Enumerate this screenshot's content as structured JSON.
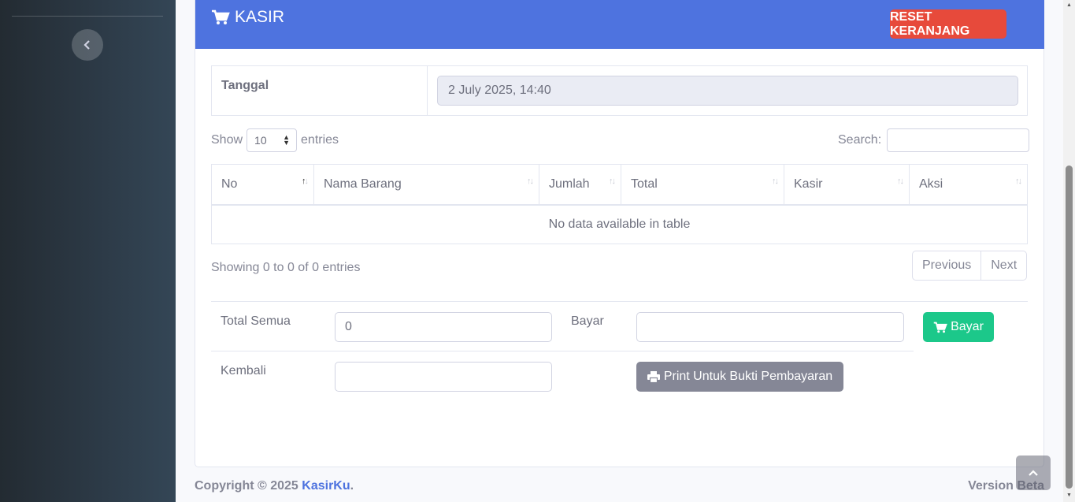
{
  "header": {
    "title": "KASIR",
    "reset_label": "RESET KERANJANG",
    "icon": "shopping-cart-icon"
  },
  "date": {
    "label": "Tanggal",
    "value": "2 July 2025, 14:40"
  },
  "table_controls": {
    "show_label": "Show",
    "entries_value": "10",
    "entries_label": "entries",
    "search_label": "Search:"
  },
  "table": {
    "columns": [
      "No",
      "Nama Barang",
      "Jumlah",
      "Total",
      "Kasir",
      "Aksi"
    ],
    "empty_message": "No data available in table",
    "info": "Showing 0 to 0 of 0 entries",
    "previous": "Previous",
    "next": "Next"
  },
  "payment": {
    "total_label": "Total Semua",
    "total_value": "0",
    "bayar_label": "Bayar",
    "bayar_button": "Bayar",
    "kembali_label": "Kembali",
    "print_button": "Print Untuk Bukti Pembayaran"
  },
  "footer": {
    "copyright": "Copyright © 2025",
    "brand": "KasirKu",
    "dot": ".",
    "version": "Version Beta"
  },
  "colors": {
    "primary": "#4e73df",
    "danger": "#e74a3b",
    "success": "#1cc88a",
    "secondary": "#858796"
  }
}
